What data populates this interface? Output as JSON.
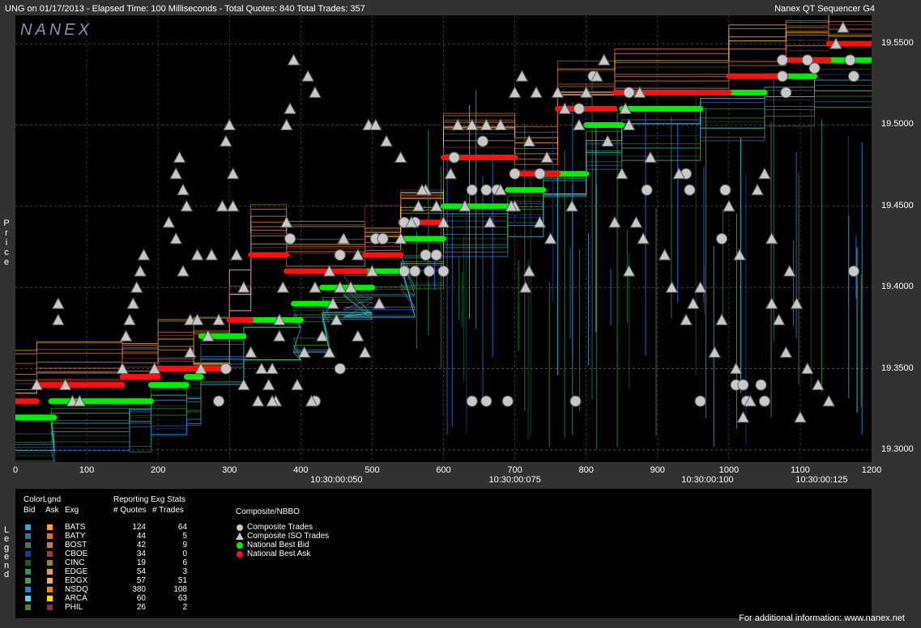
{
  "header": {
    "left": "UNG on 01/17/2013  -  Elapsed Time: 100 Milliseconds  -  Total Quotes: 840  Total Trades: 357",
    "right": "Nanex QT Sequencer G4"
  },
  "logo_text": "NANEX",
  "y_axis_title": "Price",
  "legend_side_title": "Legend",
  "colors": {
    "nbb": "#00ee00",
    "nba": "#ff1010",
    "trade": "#c8c8c8",
    "grid": "#555555"
  },
  "chart_data": {
    "type": "scatter",
    "xlim": [
      0,
      1200
    ],
    "ylim": [
      19.2925,
      19.5675
    ],
    "x_ticks": [
      "0",
      "100",
      "200",
      "300",
      "400",
      "500",
      "600",
      "700",
      "800",
      "900",
      "1000",
      "1100",
      "1200"
    ],
    "y_ticks": [
      "19.3000",
      "19.3500",
      "19.4000",
      "19.4500",
      "19.5000",
      "19.5500"
    ],
    "time_ticks": [
      {
        "x": 450,
        "label": "10:30:00:050"
      },
      {
        "x": 700,
        "label": "10:30:00:075"
      },
      {
        "x": 970,
        "label": "10:30:00:100"
      },
      {
        "x": 1130,
        "label": "10:30:00:125"
      }
    ],
    "nbb_segments": [
      [
        0,
        55,
        19.32
      ],
      [
        50,
        160,
        19.33
      ],
      [
        160,
        190,
        19.33
      ],
      [
        190,
        240,
        19.34
      ],
      [
        240,
        260,
        19.345
      ],
      [
        260,
        320,
        19.37
      ],
      [
        320,
        400,
        19.38
      ],
      [
        390,
        440,
        19.39
      ],
      [
        430,
        500,
        19.4
      ],
      [
        460,
        560,
        19.41
      ],
      [
        540,
        600,
        19.43
      ],
      [
        600,
        690,
        19.45
      ],
      [
        690,
        740,
        19.46
      ],
      [
        740,
        800,
        19.47
      ],
      [
        800,
        850,
        19.5
      ],
      [
        850,
        960,
        19.51
      ],
      [
        960,
        1050,
        19.52
      ],
      [
        1050,
        1120,
        19.53
      ],
      [
        1120,
        1200,
        19.54
      ]
    ],
    "nba_segments": [
      [
        0,
        30,
        19.33
      ],
      [
        30,
        150,
        19.34
      ],
      [
        150,
        200,
        19.345
      ],
      [
        200,
        250,
        19.35
      ],
      [
        250,
        300,
        19.35
      ],
      [
        300,
        330,
        19.38
      ],
      [
        330,
        380,
        19.42
      ],
      [
        380,
        490,
        19.41
      ],
      [
        490,
        540,
        19.42
      ],
      [
        540,
        600,
        19.44
      ],
      [
        600,
        700,
        19.48
      ],
      [
        700,
        760,
        19.47
      ],
      [
        760,
        840,
        19.51
      ],
      [
        840,
        1000,
        19.52
      ],
      [
        1000,
        1080,
        19.53
      ],
      [
        1080,
        1140,
        19.54
      ],
      [
        1140,
        1200,
        19.55
      ]
    ],
    "composite_trades": [
      [
        285,
        19.33
      ],
      [
        295,
        19.35
      ],
      [
        455,
        19.35
      ],
      [
        455,
        19.42
      ],
      [
        455,
        19.42
      ],
      [
        505,
        19.43
      ],
      [
        515,
        19.43
      ],
      [
        560,
        19.44
      ],
      [
        575,
        19.42
      ],
      [
        590,
        19.42
      ],
      [
        545,
        19.41
      ],
      [
        560,
        19.41
      ],
      [
        580,
        19.41
      ],
      [
        600,
        19.41
      ],
      [
        615,
        19.48
      ],
      [
        640,
        19.46
      ],
      [
        660,
        19.46
      ],
      [
        675,
        19.46
      ],
      [
        700,
        19.47
      ],
      [
        735,
        19.47
      ],
      [
        790,
        19.51
      ],
      [
        810,
        19.53
      ],
      [
        860,
        19.52
      ],
      [
        885,
        19.46
      ],
      [
        940,
        19.47
      ],
      [
        945,
        19.46
      ],
      [
        990,
        19.43
      ],
      [
        995,
        19.46
      ],
      [
        1010,
        19.34
      ],
      [
        1020,
        19.34
      ],
      [
        1025,
        19.33
      ],
      [
        1045,
        19.34
      ],
      [
        1050,
        19.33
      ],
      [
        1075,
        19.53
      ],
      [
        1110,
        19.54
      ],
      [
        1170,
        19.54
      ],
      [
        1175,
        19.41
      ],
      [
        1175,
        19.53
      ],
      [
        1075,
        19.54
      ],
      [
        655,
        19.49
      ],
      [
        420,
        19.33
      ],
      [
        640,
        19.33
      ],
      [
        660,
        19.33
      ],
      [
        690,
        19.33
      ],
      [
        785,
        19.33
      ],
      [
        960,
        19.33
      ],
      [
        385,
        19.43
      ],
      [
        545,
        19.44
      ],
      [
        1120,
        19.535
      ],
      [
        1080,
        19.52
      ]
    ],
    "iso_trades": [
      [
        30,
        19.34
      ],
      [
        60,
        19.38
      ],
      [
        60,
        19.39
      ],
      [
        70,
        19.34
      ],
      [
        80,
        19.33
      ],
      [
        90,
        19.33
      ],
      [
        150,
        19.35
      ],
      [
        155,
        19.37
      ],
      [
        160,
        19.38
      ],
      [
        165,
        19.39
      ],
      [
        170,
        19.4
      ],
      [
        175,
        19.41
      ],
      [
        180,
        19.42
      ],
      [
        195,
        19.35
      ],
      [
        215,
        19.44
      ],
      [
        225,
        19.47
      ],
      [
        230,
        19.48
      ],
      [
        235,
        19.46
      ],
      [
        240,
        19.45
      ],
      [
        245,
        19.38
      ],
      [
        245,
        19.36
      ],
      [
        255,
        19.42
      ],
      [
        270,
        19.37
      ],
      [
        285,
        19.38
      ],
      [
        295,
        19.49
      ],
      [
        300,
        19.5
      ],
      [
        305,
        19.47
      ],
      [
        305,
        19.45
      ],
      [
        310,
        19.42
      ],
      [
        320,
        19.4
      ],
      [
        330,
        19.36
      ],
      [
        340,
        19.33
      ],
      [
        355,
        19.34
      ],
      [
        360,
        19.35
      ],
      [
        370,
        19.38
      ],
      [
        375,
        19.4
      ],
      [
        380,
        19.5
      ],
      [
        385,
        19.51
      ],
      [
        390,
        19.54
      ],
      [
        410,
        19.53
      ],
      [
        420,
        19.52
      ],
      [
        430,
        19.37
      ],
      [
        440,
        19.36
      ],
      [
        445,
        19.39
      ],
      [
        450,
        19.38
      ],
      [
        455,
        19.4
      ],
      [
        460,
        19.43
      ],
      [
        470,
        19.4
      ],
      [
        480,
        19.37
      ],
      [
        490,
        19.36
      ],
      [
        495,
        19.5
      ],
      [
        505,
        19.5
      ],
      [
        520,
        19.49
      ],
      [
        540,
        19.48
      ],
      [
        555,
        19.44
      ],
      [
        565,
        19.45
      ],
      [
        575,
        19.46
      ],
      [
        590,
        19.45
      ],
      [
        600,
        19.44
      ],
      [
        620,
        19.5
      ],
      [
        640,
        19.5
      ],
      [
        660,
        19.5
      ],
      [
        680,
        19.5
      ],
      [
        700,
        19.45
      ],
      [
        715,
        19.4
      ],
      [
        720,
        19.41
      ],
      [
        735,
        19.44
      ],
      [
        750,
        19.43
      ],
      [
        780,
        19.45
      ],
      [
        800,
        19.52
      ],
      [
        815,
        19.53
      ],
      [
        825,
        19.54
      ],
      [
        840,
        19.44
      ],
      [
        860,
        19.41
      ],
      [
        880,
        19.43
      ],
      [
        910,
        19.42
      ],
      [
        930,
        19.47
      ],
      [
        950,
        19.39
      ],
      [
        960,
        19.4
      ],
      [
        1000,
        19.45
      ],
      [
        1010,
        19.35
      ],
      [
        1020,
        19.32
      ],
      [
        1030,
        19.33
      ],
      [
        1040,
        19.46
      ],
      [
        1050,
        19.47
      ],
      [
        1060,
        19.39
      ],
      [
        1070,
        19.38
      ],
      [
        1080,
        19.36
      ],
      [
        1100,
        19.32
      ],
      [
        1110,
        19.35
      ],
      [
        1125,
        19.34
      ],
      [
        1140,
        19.33
      ],
      [
        1150,
        19.55
      ],
      [
        1160,
        19.56
      ],
      [
        860,
        19.5
      ],
      [
        855,
        19.51
      ],
      [
        700,
        19.52
      ],
      [
        710,
        19.53
      ],
      [
        730,
        19.52
      ],
      [
        760,
        19.52
      ],
      [
        770,
        19.51
      ],
      [
        790,
        19.5
      ],
      [
        875,
        19.52
      ],
      [
        365,
        19.33
      ],
      [
        395,
        19.34
      ],
      [
        405,
        19.36
      ],
      [
        415,
        19.33
      ],
      [
        225,
        19.43
      ],
      [
        235,
        19.41
      ],
      [
        255,
        19.38
      ],
      [
        260,
        19.35
      ],
      [
        275,
        19.42
      ],
      [
        290,
        19.45
      ],
      [
        320,
        19.34
      ],
      [
        345,
        19.35
      ],
      [
        360,
        19.33
      ],
      [
        370,
        19.37
      ],
      [
        380,
        19.44
      ],
      [
        420,
        19.4
      ],
      [
        440,
        19.41
      ],
      [
        480,
        19.42
      ],
      [
        500,
        19.41
      ],
      [
        510,
        19.39
      ],
      [
        540,
        19.43
      ],
      [
        570,
        19.46
      ],
      [
        610,
        19.47
      ],
      [
        630,
        19.45
      ],
      [
        665,
        19.44
      ],
      [
        680,
        19.46
      ],
      [
        695,
        19.45
      ],
      [
        720,
        19.49
      ],
      [
        745,
        19.48
      ],
      [
        830,
        19.49
      ],
      [
        850,
        19.47
      ],
      [
        870,
        19.44
      ],
      [
        890,
        19.48
      ],
      [
        920,
        19.4
      ],
      [
        940,
        19.38
      ],
      [
        980,
        19.36
      ],
      [
        990,
        19.38
      ],
      [
        1015,
        19.42
      ],
      [
        1060,
        19.43
      ],
      [
        1085,
        19.41
      ],
      [
        1095,
        19.39
      ]
    ]
  },
  "legend": {
    "colorlgnd": "ColorLgnd",
    "bid": "Bid",
    "ask": "Ask",
    "exg": "Exg",
    "reporting": "Reporting Exg Stats",
    "quotes_col": "# Quotes",
    "trades_col": "# Trades",
    "rows": [
      {
        "exg": "BATS",
        "quotes": "124",
        "trades": "64",
        "bid_color": "#40a0e0",
        "ask_color": "#ffa040"
      },
      {
        "exg": "BATY",
        "quotes": "44",
        "trades": "5",
        "bid_color": "#3070c0",
        "ask_color": "#e07020"
      },
      {
        "exg": "BOST",
        "quotes": "42",
        "trades": "9",
        "bid_color": "#308060",
        "ask_color": "#c08050"
      },
      {
        "exg": "CBOE",
        "quotes": "34",
        "trades": "0",
        "bid_color": "#1040a0",
        "ask_color": "#a04020"
      },
      {
        "exg": "CINC",
        "quotes": "19",
        "trades": "6",
        "bid_color": "#106030",
        "ask_color": "#a08030"
      },
      {
        "exg": "EDGE",
        "quotes": "54",
        "trades": "3",
        "bid_color": "#20a040",
        "ask_color": "#e0a060"
      },
      {
        "exg": "EDGX",
        "quotes": "57",
        "trades": "51",
        "bid_color": "#40a060",
        "ask_color": "#f0b070"
      },
      {
        "exg": "NSDQ",
        "quotes": "380",
        "trades": "108",
        "bid_color": "#2080ff",
        "ask_color": "#ff8020"
      },
      {
        "exg": "ARCA",
        "quotes": "60",
        "trades": "63",
        "bid_color": "#40e0f0",
        "ask_color": "#ffe000"
      },
      {
        "exg": "PHIL",
        "quotes": "26",
        "trades": "2",
        "bid_color": "#608030",
        "ask_color": "#803050"
      }
    ],
    "nbbo_title": "Composite/NBBO",
    "nbbo_items": [
      {
        "label": "Composite Trades"
      },
      {
        "label": "Composite ISO Trades"
      },
      {
        "label": "National Best Bid"
      },
      {
        "label": "National Best Ask"
      }
    ]
  },
  "footer": "For additional information: www.nanex.net"
}
